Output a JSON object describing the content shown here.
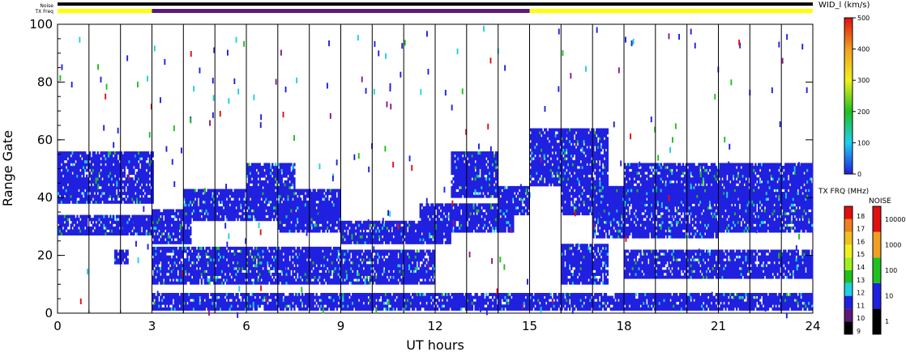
{
  "header": {
    "noise_label": "Noise",
    "txfreq_label": "TX Freq"
  },
  "chart_data": {
    "type": "heatmap",
    "xlabel": "UT hours",
    "ylabel": "Range Gate",
    "xlim": [
      0,
      24
    ],
    "ylim": [
      0,
      100
    ],
    "xticks": [
      "0",
      "3",
      "6",
      "9",
      "12",
      "15",
      "18",
      "21",
      "24"
    ],
    "yticks": [
      "0",
      "20",
      "40",
      "60",
      "80",
      "100"
    ],
    "grid_x_every_hours": 1,
    "tx_freq_bar": [
      {
        "from": 0,
        "to": 3,
        "color": "#ffff00"
      },
      {
        "from": 3,
        "to": 15,
        "color": "#5a1a78"
      },
      {
        "from": 15,
        "to": 24,
        "color": "#ffff00"
      }
    ],
    "bands": [
      {
        "x0": 0,
        "x1": 3,
        "y0": 38,
        "y1": 56
      },
      {
        "x0": 0,
        "x1": 3,
        "y0": 27,
        "y1": 34
      },
      {
        "x0": 1.8,
        "x1": 2.2,
        "y0": 17,
        "y1": 22
      },
      {
        "x0": 3,
        "x1": 4.2,
        "y0": 24,
        "y1": 36
      },
      {
        "x0": 3,
        "x1": 9,
        "y0": 10,
        "y1": 23
      },
      {
        "x0": 4,
        "x1": 9,
        "y0": 32,
        "y1": 43
      },
      {
        "x0": 6,
        "x1": 7.5,
        "y0": 40,
        "y1": 52
      },
      {
        "x0": 7,
        "x1": 9,
        "y0": 28,
        "y1": 38
      },
      {
        "x0": 9,
        "x1": 12,
        "y0": 10,
        "y1": 22
      },
      {
        "x0": 9,
        "x1": 12.5,
        "y0": 24,
        "y1": 32
      },
      {
        "x0": 11.5,
        "x1": 14.5,
        "y0": 28,
        "y1": 38
      },
      {
        "x0": 12.5,
        "x1": 14,
        "y0": 40,
        "y1": 56
      },
      {
        "x0": 14,
        "x1": 15,
        "y0": 34,
        "y1": 44
      },
      {
        "x0": 3,
        "x1": 24,
        "y0": 1,
        "y1": 7
      },
      {
        "x0": 15,
        "x1": 17.5,
        "y0": 44,
        "y1": 64
      },
      {
        "x0": 16,
        "x1": 18,
        "y0": 34,
        "y1": 44
      },
      {
        "x0": 16,
        "x1": 17.5,
        "y0": 10,
        "y1": 24
      },
      {
        "x0": 17,
        "x1": 21,
        "y0": 26,
        "y1": 44
      },
      {
        "x0": 18,
        "x1": 24,
        "y0": 38,
        "y1": 52
      },
      {
        "x0": 21,
        "x1": 24,
        "y0": 28,
        "y1": 42
      },
      {
        "x0": 18,
        "x1": 24,
        "y0": 12,
        "y1": 22
      }
    ],
    "colorbars": [
      {
        "title": "WID_l (km/s)",
        "ticks": [
          "0",
          "100",
          "200",
          "300",
          "400",
          "500"
        ]
      },
      {
        "title": "TX FRQ (MHz)",
        "ticks": [
          "9",
          "10",
          "11",
          "12",
          "13",
          "14",
          "15",
          "16",
          "17",
          "18"
        ]
      },
      {
        "title": "NOISE",
        "ticks": [
          "1",
          "10",
          "100",
          "1000",
          "10000"
        ]
      }
    ]
  }
}
